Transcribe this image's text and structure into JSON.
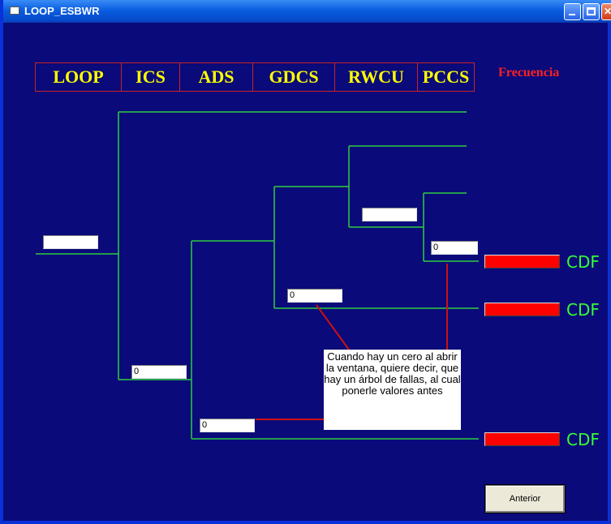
{
  "window": {
    "title": "LOOP_ESBWR"
  },
  "header": {
    "columns": [
      "LOOP",
      "ICS",
      "ADS",
      "GDCS",
      "RWCU",
      "PCCS"
    ],
    "frequency_label": "Frecuencia"
  },
  "fields": {
    "loop": "",
    "ics": "0",
    "ads": "0",
    "gdcs": "0",
    "rwcu": "",
    "pccs": "0"
  },
  "outcomes": [
    "CDF",
    "CDF",
    "CDF"
  ],
  "note": "Cuando hay un cero al abrir la ventana, quiere decir, que hay un árbol de fallas, al cual ponerle valores antes",
  "buttons": {
    "back": "Anterior"
  },
  "colors": {
    "background": "#0a0a7a",
    "header_text": "#ffff00",
    "header_border": "#cc2222",
    "frequency": "#ff2020",
    "branch_lines": "#2ecc40",
    "outcome_box": "#ff0000",
    "outcome_text": "#33ff33",
    "callout_lines": "#cc1111"
  }
}
